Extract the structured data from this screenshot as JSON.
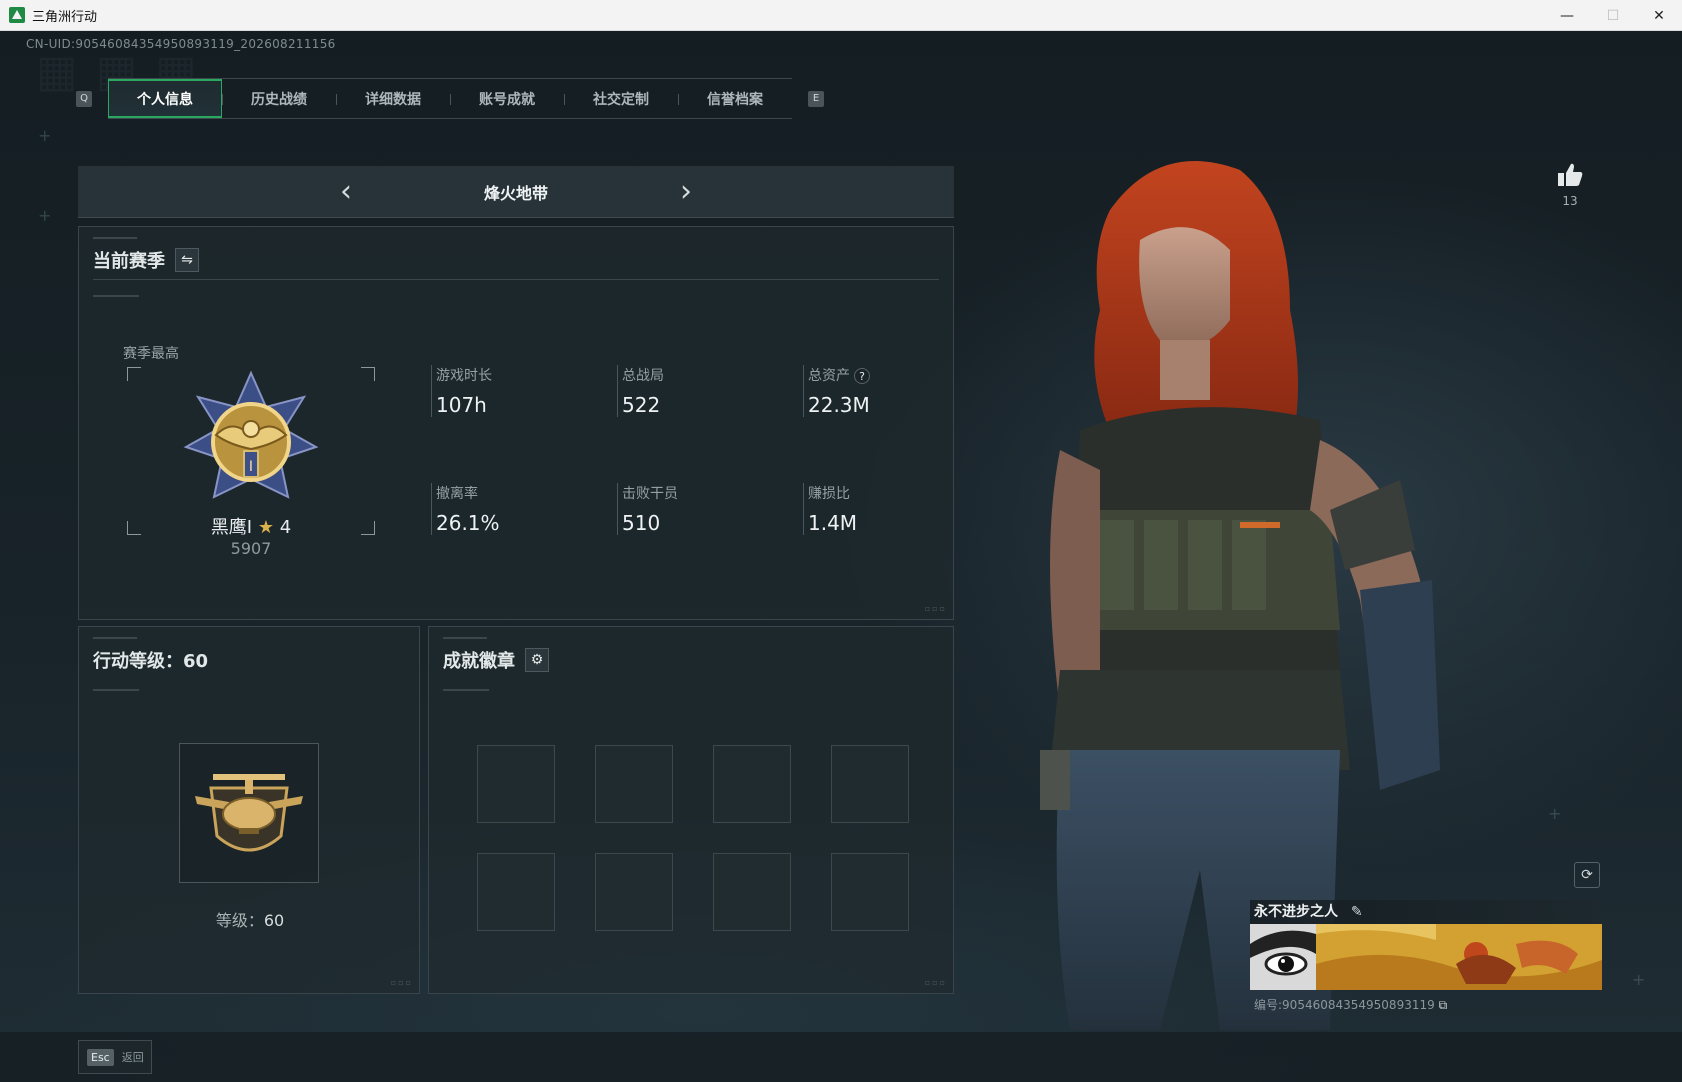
{
  "window": {
    "title": "三角洲行动",
    "controls": [
      "minimize",
      "maximize",
      "close"
    ]
  },
  "uid_text": "CN-UID:9054608435495089311​9_202608211156",
  "tabs": {
    "left_key": "Q",
    "right_key": "E",
    "items": [
      {
        "label": "个人信息",
        "active": true
      },
      {
        "label": "历史战绩",
        "active": false
      },
      {
        "label": "详细数据",
        "active": false
      },
      {
        "label": "账号成就",
        "active": false
      },
      {
        "label": "社交定制",
        "active": false
      },
      {
        "label": "信誉档案",
        "active": false
      }
    ]
  },
  "mode": {
    "title": "烽火地带",
    "prev_icon": "chevron-left-icon",
    "next_icon": "chevron-right-icon"
  },
  "season": {
    "title": "当前赛季",
    "switch_icon": "swap-icon",
    "best_label": "赛季最高",
    "rank_name": "黑鹰Ⅰ",
    "rank_stars": "4",
    "rank_score": "5907",
    "stats": [
      {
        "label": "游戏时长",
        "value": "107h"
      },
      {
        "label": "总战局",
        "value": "522"
      },
      {
        "label": "总资产",
        "value": "22.3M",
        "help": "?"
      },
      {
        "label": "撤离率",
        "value": "26.1%"
      },
      {
        "label": "击败干员",
        "value": "510"
      },
      {
        "label": "赚损比",
        "value": "1.4M"
      }
    ]
  },
  "level": {
    "title": "行动等级：60",
    "level_label": "等级：",
    "level_value": "60"
  },
  "achievements": {
    "title": "成就徽章",
    "settings_icon": "gear-icon",
    "slot_count": 8
  },
  "likes": {
    "icon": "thumbs-up-icon",
    "count": "13"
  },
  "card": {
    "name": "永不进步之人",
    "edit_icon": "pencil-icon",
    "id_text": "编号:90546084354950893119",
    "copy_icon": "copy-icon"
  },
  "bottom": {
    "esc_key": "Esc",
    "esc_label": "返回"
  },
  "colors": {
    "accent_green": "#2aa85f",
    "background": "#182329"
  }
}
